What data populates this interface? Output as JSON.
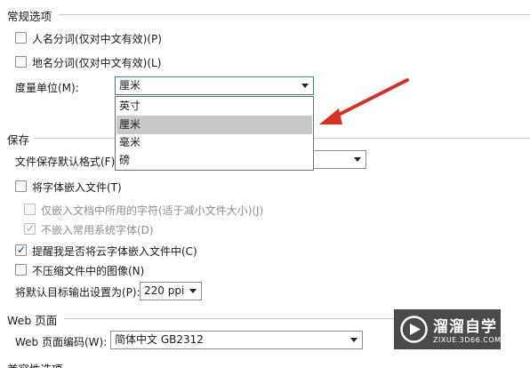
{
  "general": {
    "title": "常规选项",
    "person_name": "人名分词(仅对中文有效)(P)",
    "place_name": "地名分词(仅对中文有效)(L)",
    "unit_label": "度量单位(M):",
    "unit_value": "厘米",
    "unit_options": [
      "英寸",
      "厘米",
      "毫米",
      "磅"
    ]
  },
  "save": {
    "title": "保存",
    "format_label": "文件保存默认格式(F):",
    "embed_fonts": "将字体嵌入文件(T)",
    "only_used_chars": "仅嵌入文档中所用的字符(适于减小文件大小)(J)",
    "no_common_fonts": "不嵌入常用系统字体(D)",
    "remind_cloud_fonts": "提醒我是否将云字体嵌入文件中(C)",
    "no_compress_images": "不压缩文件中的图像(N)",
    "target_output_label": "将默认目标输出设置为(P):",
    "target_output_value": "220 ppi"
  },
  "web": {
    "title": "Web 页面",
    "encoding_label": "Web 页面编码(W):",
    "encoding_value": "简体中文 GB2312"
  },
  "compat": {
    "title": "兼容性选项"
  },
  "watermark": {
    "brand": "溜溜自学",
    "url": "ZIXUE.3D66.COM"
  },
  "colors": {
    "arrow": "#d93025",
    "selected_item": "#c8c8c8"
  }
}
